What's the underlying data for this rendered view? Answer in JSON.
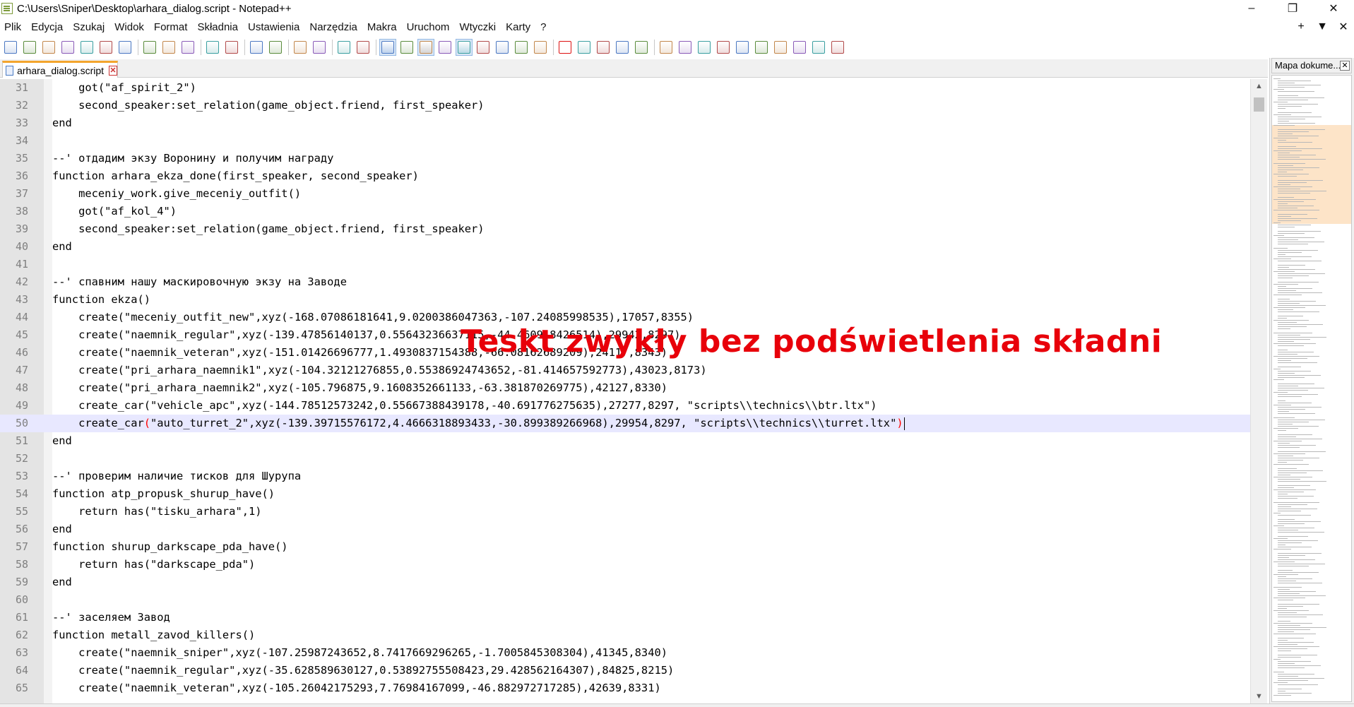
{
  "window": {
    "title": "C:\\Users\\Sniper\\Desktop\\arhara_dialog.script - Notepad++",
    "minimize": "–",
    "restore": "❐",
    "close": "✕"
  },
  "menu": {
    "items": [
      "Plik",
      "Edycja",
      "Szukaj",
      "Widok",
      "Format",
      "Składnia",
      "Ustawienia",
      "Narzędzia",
      "Makra",
      "Uruchom",
      "Wtyczki",
      "Karty",
      "?"
    ],
    "right": {
      "add": "+",
      "dropdown": "▼",
      "close": "✕"
    }
  },
  "toolbar": {
    "icons": [
      "new-file-icon",
      "open-file-icon",
      "save-icon",
      "save-all-icon",
      "close-icon",
      "close-all-icon",
      "print-icon",
      "cut-icon",
      "copy-icon",
      "paste-icon",
      "undo-icon",
      "redo-icon",
      "find-icon",
      "replace-icon",
      "zoom-in-icon",
      "zoom-out-icon",
      "sync-vertical-icon",
      "sync-horizontal-icon",
      "word-wrap-icon",
      "show-all-chars-icon",
      "indent-guide-icon",
      "udl-icon",
      "doc-map-icon",
      "function-list-icon",
      "folder-workspace-icon",
      "monitoring-icon",
      "eye-icon",
      "record-macro-icon",
      "stop-macro-icon",
      "play-macro-icon",
      "run-macro-multiple-icon",
      "save-macro-icon",
      "plugin-1-icon",
      "plugin-2-icon",
      "plugin-3-icon",
      "plugin-4-icon",
      "plugin-5-icon",
      "plugin-6-icon",
      "plugin-7-icon",
      "plugin-8-icon",
      "plugin-9-icon",
      "plugin-10-icon"
    ],
    "accent": "#3a5f9f"
  },
  "tab": {
    "label": "arhara_dialog.script",
    "close": "✕"
  },
  "editor": {
    "current_line": 50,
    "lines": [
      {
        "n": "31",
        "text": "    got(\"af_spirit_2\")"
      },
      {
        "n": "32",
        "text": "    second_speaker:set_relation(game_object.friend, first_speaker)"
      },
      {
        "n": "33",
        "text": "end"
      },
      {
        "n": "34",
        "text": ""
      },
      {
        "n": "35",
        "text": "--' отдадим экзу Воронину и получим награду"
      },
      {
        "n": "36",
        "text": "function arhara_ekza_done(first_speaker, second_speaker)"
      },
      {
        "n": "37",
        "text": "    meceniy_work.give_meceniy_outfit()"
      },
      {
        "n": "38",
        "text": "    got(\"af_kol_4\")"
      },
      {
        "n": "39",
        "text": "    second_speaker:set_relation(game_object.friend, first_speaker)"
      },
      {
        "n": "40",
        "text": "end"
      },
      {
        "n": "41",
        "text": ""
      },
      {
        "n": "42",
        "text": "--' спавним нашу маскировочную экзу на Заводе"
      },
      {
        "n": "43",
        "text": "function ekza()"
      },
      {
        "n": "44",
        "text": "    create(\"meceniy_outfit_new\",xyz(-168.07086181641,9.0200386047363,-107.24085998535),17057,8355)"
      },
      {
        "n": "45",
        "text": "    create(\"naemnik_regular\",xyz(-139.47856140137,0.55643236637115,-44.460918426514),29942,8297)"
      },
      {
        "n": "46",
        "text": "    create(\"naemnik_veteran\",xyz(-151.01426696777,1.4930837154388,-66.08162689209),24117,8343)"
      },
      {
        "n": "47",
        "text": "    create(\"pri_arhara_naemnik1\",xyz(-104.32121276855,0.55386924743652,-81.414657592773),43023,8173)"
      },
      {
        "n": "48",
        "text": "    create(\"pri_arhara_naemnik2\",xyz(-105.796875,9.1608352661133,-63.381870269775),42127,8330)"
      },
      {
        "n": "49",
        "text": "    create_car(\"vehicle_apc\",xyz(-144.78512573242,0.55667388439178,-40.691776275635),27277,8297, \"scripts\\\\technics\\\\btr.ltx\")"
      },
      {
        "n": "50",
        "pre": "    create_car",
        "open": "(",
        "mid": "\"auto_turret_2\",xyz(-139.39715576172,4.4666318893433,-30.899389266968),29954,8297, \"scripts\\\\technics\\\\turret.ltx\"",
        "close": ")"
      },
      {
        "n": "51",
        "text": "end"
      },
      {
        "n": "52",
        "text": ""
      },
      {
        "n": "53",
        "text": "--' проверим наличие тисков для Шурупа"
      },
      {
        "n": "54",
        "text": "function atp_propusk_shurup_have()"
      },
      {
        "n": "55",
        "text": "    return has(\"tisku_arhara\",1)"
      },
      {
        "n": "56",
        "text": "end"
      },
      {
        "n": "57",
        "text": "function shurup_darkscape_pda_have()"
      },
      {
        "n": "58",
        "text": "    return has(\"darkscape_pda\")"
      },
      {
        "n": "59",
        "text": "end"
      },
      {
        "n": "60",
        "text": ""
      },
      {
        "n": "61",
        "text": "--' заселяем Завод"
      },
      {
        "n": "62",
        "text": "function metall_zavod_killers()"
      },
      {
        "n": "63",
        "text": "    create(\"naemnik_sniper\",xyz(-107.25987243652,8.7417669296265,-1.7005845308304),41345,8340)"
      },
      {
        "n": "64",
        "text": "    create(\"naemnik_regular\",xyz(-35.628589630127,0.53892755508423,29.428562164307),84825,8215)"
      },
      {
        "n": "65",
        "text": "    create(\"naemnik_veteran\",xyz(-105.26042175293,7.76984167099,-46.882972717285),42639,8331)"
      }
    ]
  },
  "overlay": {
    "text": "Teskt zwykły bez podświetlenia składni",
    "color": "#e8000a"
  },
  "scrollbar": {
    "up": "▲",
    "down": "▼"
  },
  "document_map": {
    "title": "Mapa dokume...",
    "close": "✕",
    "highlight_color": "#fde4c8"
  }
}
